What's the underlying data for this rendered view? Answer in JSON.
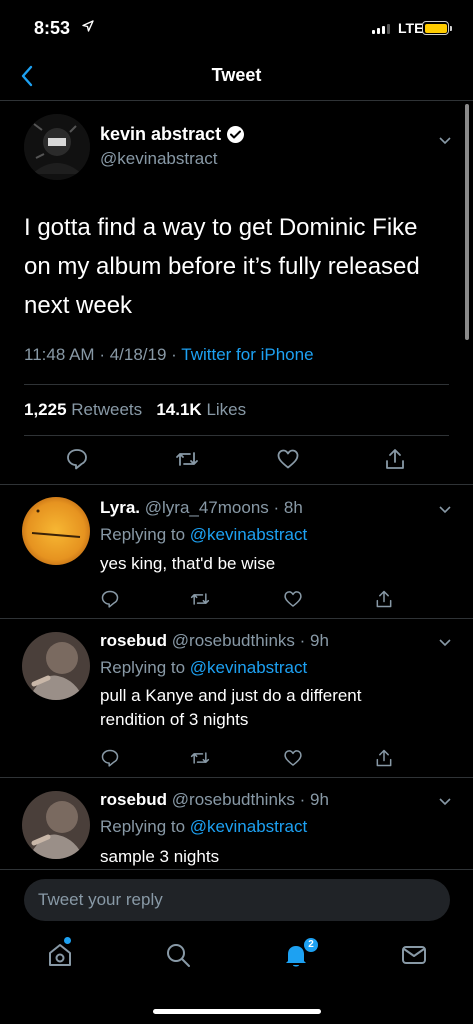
{
  "status_bar": {
    "time": "8:53",
    "network": "LTE"
  },
  "nav": {
    "title": "Tweet"
  },
  "tweet": {
    "author_name": "kevin abstract",
    "author_handle": "@kevinabstract",
    "text": "I gotta find a way to get Dominic Fike on my album before it’s fully released next week",
    "time": "11:48 AM",
    "date": "4/18/19",
    "client": "Twitter for iPhone",
    "retweets_count": "1,225",
    "retweets_label": "Retweets",
    "likes_count": "14.1K",
    "likes_label": "Likes"
  },
  "replies": [
    {
      "name": "Lyra.",
      "handle": "@lyra_47moons",
      "age": "8h",
      "replying_prefix": "Replying to",
      "mention": "@kevinabstract",
      "text": "yes king, that'd be wise"
    },
    {
      "name": "rosebud",
      "handle": "@rosebudthinks",
      "age": "9h",
      "replying_prefix": "Replying to",
      "mention": "@kevinabstract",
      "text": "pull a Kanye and just do a different rendition of 3 nights"
    },
    {
      "name": "rosebud",
      "handle": "@rosebudthinks",
      "age": "9h",
      "replying_prefix": "Replying to",
      "mention": "@kevinabstract",
      "text": "sample 3 nights"
    }
  ],
  "compose": {
    "placeholder": "Tweet your reply"
  },
  "tabbar": {
    "notifications_badge": "2"
  },
  "colors": {
    "accent": "#1da1f2",
    "secondary_text": "#8899a6",
    "divider": "#2f3336"
  }
}
